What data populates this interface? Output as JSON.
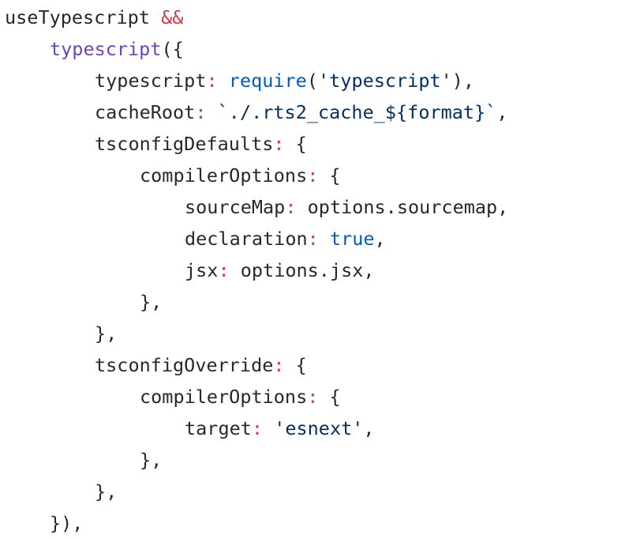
{
  "colors": {
    "default": "#24292e",
    "operator": "#d73a49",
    "function": "#6f42c1",
    "builtin": "#005cc5",
    "string": "#032f62",
    "background": "#ffffff"
  },
  "code": {
    "language": "javascript",
    "lines": [
      {
        "indent": 0,
        "tokens": [
          {
            "t": "useTypescript",
            "k": "default"
          },
          {
            "t": " ",
            "k": "default"
          },
          {
            "t": "&&",
            "k": "operator"
          }
        ]
      },
      {
        "indent": 1,
        "tokens": [
          {
            "t": "typescript",
            "k": "function"
          },
          {
            "t": "({",
            "k": "punct"
          }
        ]
      },
      {
        "indent": 2,
        "tokens": [
          {
            "t": "typescript",
            "k": "default"
          },
          {
            "t": ":",
            "k": "operator"
          },
          {
            "t": " ",
            "k": "default"
          },
          {
            "t": "require",
            "k": "builtin"
          },
          {
            "t": "(",
            "k": "punct"
          },
          {
            "t": "'typescript'",
            "k": "string"
          },
          {
            "t": "),",
            "k": "punct"
          }
        ]
      },
      {
        "indent": 2,
        "tokens": [
          {
            "t": "cacheRoot",
            "k": "default"
          },
          {
            "t": ":",
            "k": "operator"
          },
          {
            "t": " ",
            "k": "default"
          },
          {
            "t": "`./.rts2_cache_${format}`",
            "k": "string"
          },
          {
            "t": ",",
            "k": "punct"
          }
        ]
      },
      {
        "indent": 2,
        "tokens": [
          {
            "t": "tsconfigDefaults",
            "k": "default"
          },
          {
            "t": ":",
            "k": "operator"
          },
          {
            "t": " {",
            "k": "punct"
          }
        ]
      },
      {
        "indent": 3,
        "tokens": [
          {
            "t": "compilerOptions",
            "k": "default"
          },
          {
            "t": ":",
            "k": "operator"
          },
          {
            "t": " {",
            "k": "punct"
          }
        ]
      },
      {
        "indent": 4,
        "tokens": [
          {
            "t": "sourceMap",
            "k": "default"
          },
          {
            "t": ":",
            "k": "operator"
          },
          {
            "t": " options.sourcemap,",
            "k": "default"
          }
        ]
      },
      {
        "indent": 4,
        "tokens": [
          {
            "t": "declaration",
            "k": "default"
          },
          {
            "t": ":",
            "k": "operator"
          },
          {
            "t": " ",
            "k": "default"
          },
          {
            "t": "true",
            "k": "builtin"
          },
          {
            "t": ",",
            "k": "punct"
          }
        ]
      },
      {
        "indent": 4,
        "tokens": [
          {
            "t": "jsx",
            "k": "default"
          },
          {
            "t": ":",
            "k": "operator"
          },
          {
            "t": " options.jsx,",
            "k": "default"
          }
        ]
      },
      {
        "indent": 3,
        "tokens": [
          {
            "t": "},",
            "k": "punct"
          }
        ]
      },
      {
        "indent": 2,
        "tokens": [
          {
            "t": "},",
            "k": "punct"
          }
        ]
      },
      {
        "indent": 2,
        "tokens": [
          {
            "t": "tsconfigOverride",
            "k": "default"
          },
          {
            "t": ":",
            "k": "operator"
          },
          {
            "t": " {",
            "k": "punct"
          }
        ]
      },
      {
        "indent": 3,
        "tokens": [
          {
            "t": "compilerOptions",
            "k": "default"
          },
          {
            "t": ":",
            "k": "operator"
          },
          {
            "t": " {",
            "k": "punct"
          }
        ]
      },
      {
        "indent": 4,
        "tokens": [
          {
            "t": "target",
            "k": "default"
          },
          {
            "t": ":",
            "k": "operator"
          },
          {
            "t": " ",
            "k": "default"
          },
          {
            "t": "'esnext'",
            "k": "string"
          },
          {
            "t": ",",
            "k": "punct"
          }
        ]
      },
      {
        "indent": 3,
        "tokens": [
          {
            "t": "},",
            "k": "punct"
          }
        ]
      },
      {
        "indent": 2,
        "tokens": [
          {
            "t": "},",
            "k": "punct"
          }
        ]
      },
      {
        "indent": 1,
        "tokens": [
          {
            "t": "}),",
            "k": "punct"
          }
        ]
      }
    ]
  }
}
